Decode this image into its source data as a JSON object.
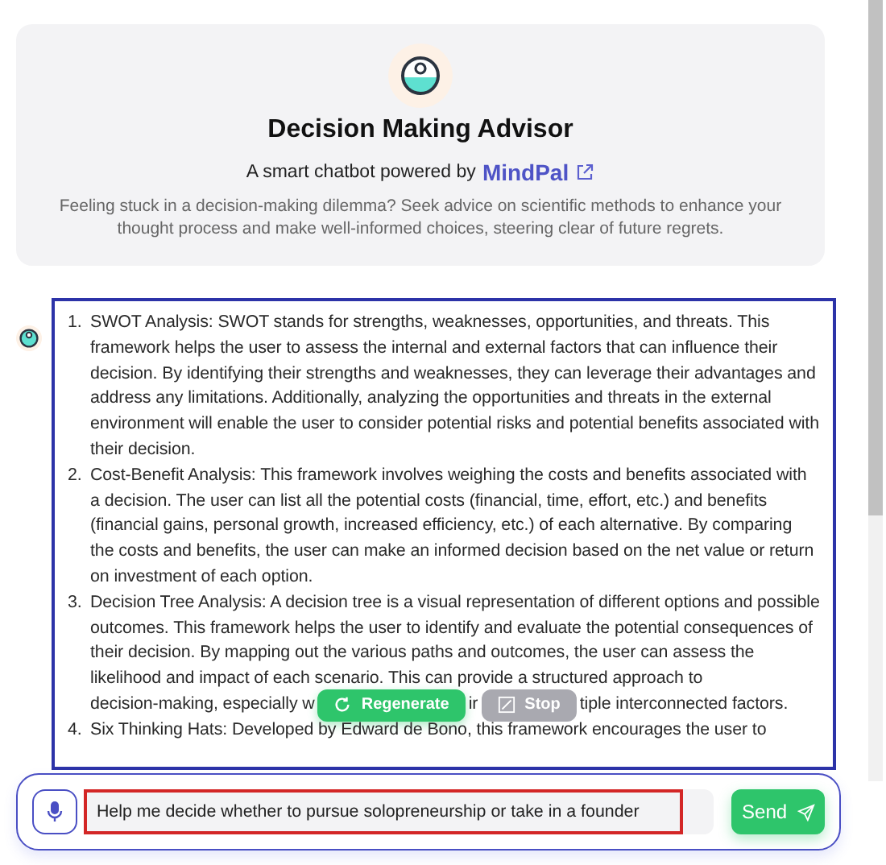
{
  "header": {
    "title": "Decision Making Advisor",
    "powered_by": "A smart chatbot powered by",
    "brand": "MindPal",
    "description": "Feeling stuck in a decision-making dilemma? Seek advice on scientific methods to enhance your thought process and make well-informed choices, steering clear of future regrets."
  },
  "message": {
    "items": [
      {
        "marker": "1.",
        "text": "SWOT Analysis: SWOT stands for strengths, weaknesses, opportunities, and threats. This framework helps the user to assess the internal and external factors that can influence their decision. By identifying their strengths and weaknesses, they can leverage their advantages and address any limitations. Additionally, analyzing the opportunities and threats in the external environment will enable the user to consider potential risks and potential benefits associated with their decision."
      },
      {
        "marker": "2.",
        "text": "Cost-Benefit Analysis: This framework involves weighing the costs and benefits associated with a decision. The user can list all the potential costs (financial, time, effort, etc.) and benefits (financial gains, personal growth, increased efficiency, etc.) of each alternative. By comparing the costs and benefits, the user can make an informed decision based on the net value or return on investment of each option."
      },
      {
        "marker": "3.",
        "text": "Decision Tree Analysis: A decision tree is a visual representation of different options and possible outcomes. This framework helps the user to identify and evaluate the potential consequences of their decision. By mapping out the various paths and outcomes, the user can assess the likelihood and impact of each scenario. This can provide a structured approach to",
        "tail": [
          "decision-making, especially w",
          "ir",
          "tiple interconnected factors."
        ]
      },
      {
        "marker": "4.",
        "text": "Six Thinking Hats: Developed by Edward de Bono, this framework encourages the user to"
      }
    ]
  },
  "actions": [
    {
      "label": "Regenerate",
      "disabled": false
    },
    {
      "label": "Stop",
      "disabled": true
    }
  ],
  "composer": {
    "value": "Help me decide whether to pursue solopreneurship or take in a founder",
    "send": "Send"
  }
}
